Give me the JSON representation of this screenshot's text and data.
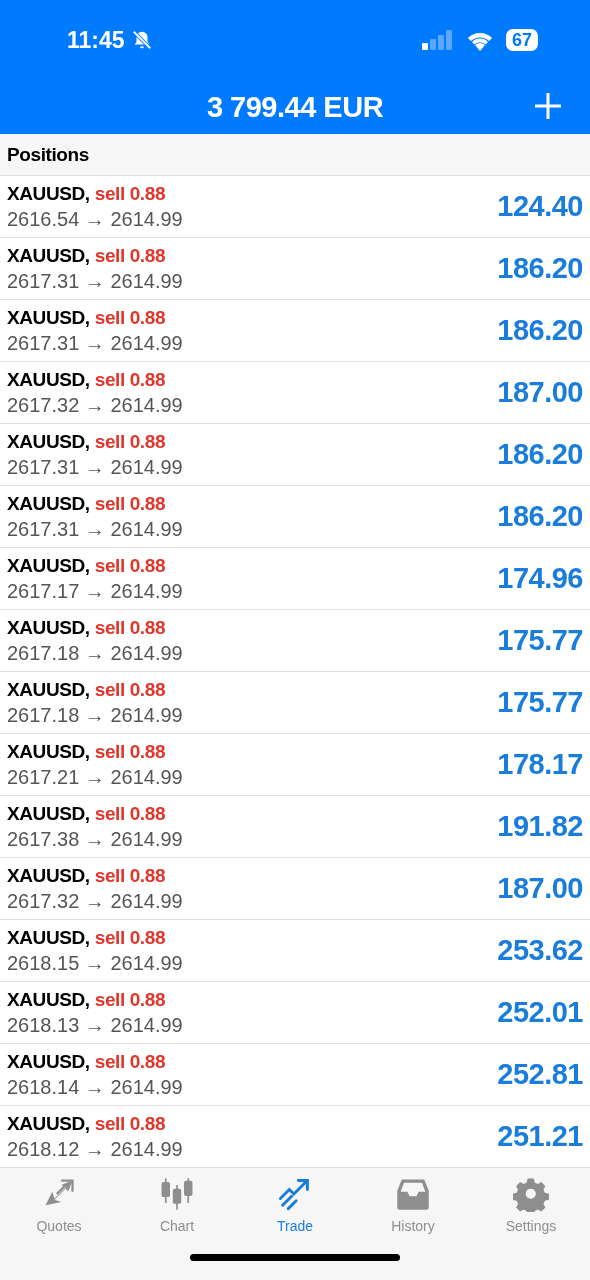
{
  "status_bar": {
    "time": "11:45",
    "battery": "67"
  },
  "header": {
    "title": "3 799.44 EUR"
  },
  "section": {
    "title": "Positions"
  },
  "positions": [
    {
      "symbol": "XAUUSD,",
      "order": "sell 0.88",
      "prices": "2616.54 → 2614.99",
      "profit": "124.40"
    },
    {
      "symbol": "XAUUSD,",
      "order": "sell 0.88",
      "prices": "2617.31 → 2614.99",
      "profit": "186.20"
    },
    {
      "symbol": "XAUUSD,",
      "order": "sell 0.88",
      "prices": "2617.31 → 2614.99",
      "profit": "186.20"
    },
    {
      "symbol": "XAUUSD,",
      "order": "sell 0.88",
      "prices": "2617.32 → 2614.99",
      "profit": "187.00"
    },
    {
      "symbol": "XAUUSD,",
      "order": "sell 0.88",
      "prices": "2617.31 → 2614.99",
      "profit": "186.20"
    },
    {
      "symbol": "XAUUSD,",
      "order": "sell 0.88",
      "prices": "2617.31 → 2614.99",
      "profit": "186.20"
    },
    {
      "symbol": "XAUUSD,",
      "order": "sell 0.88",
      "prices": "2617.17 → 2614.99",
      "profit": "174.96"
    },
    {
      "symbol": "XAUUSD,",
      "order": "sell 0.88",
      "prices": "2617.18 → 2614.99",
      "profit": "175.77"
    },
    {
      "symbol": "XAUUSD,",
      "order": "sell 0.88",
      "prices": "2617.18 → 2614.99",
      "profit": "175.77"
    },
    {
      "symbol": "XAUUSD,",
      "order": "sell 0.88",
      "prices": "2617.21 → 2614.99",
      "profit": "178.17"
    },
    {
      "symbol": "XAUUSD,",
      "order": "sell 0.88",
      "prices": "2617.38 → 2614.99",
      "profit": "191.82"
    },
    {
      "symbol": "XAUUSD,",
      "order": "sell 0.88",
      "prices": "2617.32 → 2614.99",
      "profit": "187.00"
    },
    {
      "symbol": "XAUUSD,",
      "order": "sell 0.88",
      "prices": "2618.15 → 2614.99",
      "profit": "253.62"
    },
    {
      "symbol": "XAUUSD,",
      "order": "sell 0.88",
      "prices": "2618.13 → 2614.99",
      "profit": "252.01"
    },
    {
      "symbol": "XAUUSD,",
      "order": "sell 0.88",
      "prices": "2618.14 → 2614.99",
      "profit": "252.81"
    },
    {
      "symbol": "XAUUSD,",
      "order": "sell 0.88",
      "prices": "2618.12 → 2614.99",
      "profit": "251.21"
    }
  ],
  "tab_bar": [
    {
      "kind": "quotes",
      "label": "Quotes",
      "selected": false
    },
    {
      "kind": "chart",
      "label": "Chart",
      "selected": false
    },
    {
      "kind": "trade",
      "label": "Trade",
      "selected": true
    },
    {
      "kind": "history",
      "label": "History",
      "selected": false
    },
    {
      "kind": "settings",
      "label": "Settings",
      "selected": false
    }
  ]
}
